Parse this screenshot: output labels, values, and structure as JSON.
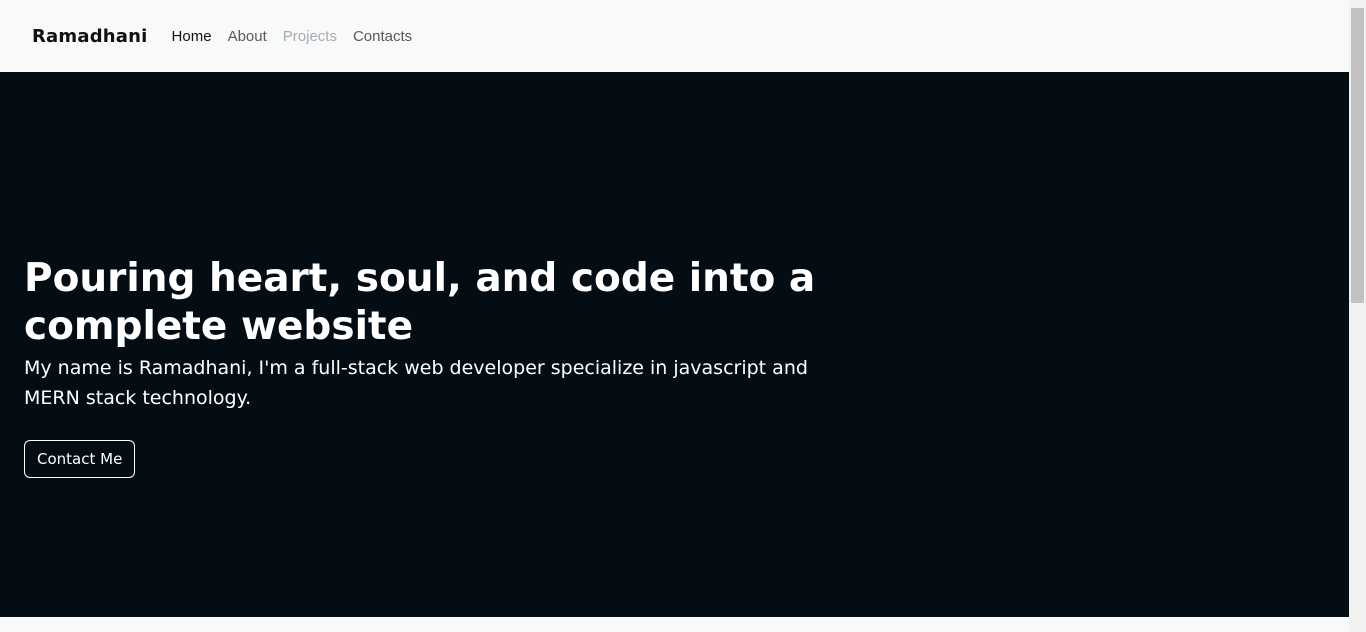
{
  "nav": {
    "brand": "Ramadhani",
    "links": [
      {
        "label": "Home",
        "state": "active"
      },
      {
        "label": "About",
        "state": "normal"
      },
      {
        "label": "Projects",
        "state": "disabled"
      },
      {
        "label": "Contacts",
        "state": "normal"
      }
    ]
  },
  "hero": {
    "title": "Pouring heart, soul, and code into a complete website",
    "subtitle": "My name is Ramadhani, I'm a full-stack web developer specialize in javascript and MERN stack technology.",
    "button_label": "Contact Me"
  },
  "colors": {
    "navbar_bg": "#f8f9fa",
    "hero_bg": "#050d14",
    "text_light": "#ffffff",
    "nav_muted": "#595959",
    "nav_disabled": "#a8abae"
  }
}
